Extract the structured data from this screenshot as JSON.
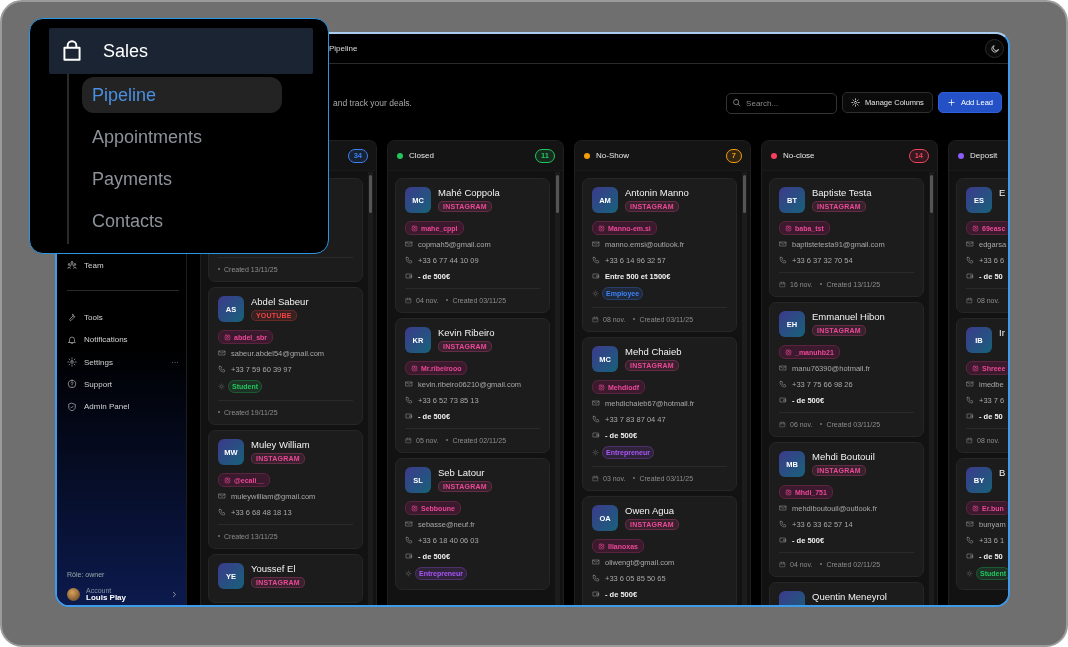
{
  "callout": {
    "group": "Sales",
    "items": [
      {
        "label": "Pipeline",
        "selected": true
      },
      {
        "label": "Appointments",
        "selected": false
      },
      {
        "label": "Payments",
        "selected": false
      },
      {
        "label": "Contacts",
        "selected": false
      }
    ]
  },
  "sidebar": {
    "items": [
      {
        "label": "Team"
      },
      {
        "label": "Tools",
        "divider_before": true
      },
      {
        "label": "Notifications"
      },
      {
        "label": "Settings",
        "more": "···"
      },
      {
        "label": "Support"
      },
      {
        "label": "Admin Panel"
      }
    ],
    "role": "Rôle: owner",
    "account": {
      "caption": "Account",
      "name": "Louis Play"
    }
  },
  "header": {
    "breadcrumb": "Pipeline"
  },
  "description": "and track your deals.",
  "toolbar": {
    "search": {
      "placeholder": "Search..."
    },
    "manage": "Manage Columns",
    "add": "Add Lead"
  },
  "columns": [
    {
      "count": "34",
      "color": "#3b82f6",
      "cards": [
        {
          "created": "Created 13/11/25"
        },
        {
          "initials": "AS",
          "name": "Abdel Sabeur",
          "source": {
            "label": "YOUTUBE",
            "color": "#ef4444"
          },
          "handle": "abdel_sbr",
          "email": "sabeur.abdel54@gmail.com",
          "phone": "+33 7 59 60 39 97",
          "tag": {
            "label": "Student",
            "color": "#22c55e"
          },
          "created": "Created 19/11/25"
        },
        {
          "initials": "MW",
          "name": "Muley William",
          "source": {
            "label": "INSTAGRAM",
            "color": "#ec4899"
          },
          "handle": "@ecali__",
          "email": "muleywilliam@gmail.com",
          "phone": "+33 6 68 48 18 13",
          "created": "Created 13/11/25"
        },
        {
          "initials": "YE",
          "name": "Youssef El",
          "source": {
            "label": "INSTAGRAM",
            "color": "#ec4899"
          }
        }
      ]
    },
    {
      "name": "Closed",
      "count": "11",
      "color": "#22c55e",
      "cards": [
        {
          "initials": "MC",
          "name": "Mahé Coppola",
          "source": {
            "label": "INSTAGRAM",
            "color": "#ec4899"
          },
          "handle": "mahe_cppl",
          "email": "copmah5@gmail.com",
          "phone": "+33 6 77 44 10 09",
          "budget": "- de 500€",
          "date": "04 nov.",
          "created": "Created 03/11/25"
        },
        {
          "initials": "KR",
          "name": "Kevin Ribeiro",
          "source": {
            "label": "INSTAGRAM",
            "color": "#ec4899"
          },
          "handle": "Mr.ribeirooo",
          "email": "kevin.ribeiro06210@gmail.com",
          "phone": "+33 6 52 73 85 13",
          "budget": "- de 500€",
          "date": "05 nov.",
          "created": "Created 02/11/25"
        },
        {
          "initials": "SL",
          "name": "Seb Latour",
          "source": {
            "label": "INSTAGRAM",
            "color": "#ec4899"
          },
          "handle": "Sebboune",
          "email": "sebasse@neuf.fr",
          "phone": "+33 6 18 40 06 03",
          "budget": "- de 500€",
          "tag": {
            "label": "Entrepreneur",
            "color": "#a855f7"
          }
        }
      ]
    },
    {
      "name": "No-Show",
      "count": "7",
      "color": "#f59e0b",
      "cards": [
        {
          "initials": "AM",
          "name": "Antonin Manno",
          "source": {
            "label": "INSTAGRAM",
            "color": "#ec4899"
          },
          "handle": "Manno-em.si",
          "email": "manno.emsi@outlook.fr",
          "phone": "+33 6 14 96 32 57",
          "budget": "Entre 500 et 1500€",
          "tag": {
            "label": "Employee",
            "color": "#3b82f6"
          },
          "date": "08 nov.",
          "created": "Created 03/11/25"
        },
        {
          "initials": "MC",
          "name": "Mehd Chaieb",
          "source": {
            "label": "INSTAGRAM",
            "color": "#ec4899"
          },
          "handle": "Mehdiodf",
          "email": "mehdichaieb67@hotmail.fr",
          "phone": "+33 7 83 87 04 47",
          "budget": "- de 500€",
          "tag": {
            "label": "Entrepreneur",
            "color": "#a855f7"
          },
          "date": "03 nov.",
          "created": "Created 03/11/25"
        },
        {
          "initials": "OA",
          "name": "Owen Agua",
          "source": {
            "label": "INSTAGRAM",
            "color": "#ec4899"
          },
          "handle": "Ilianoxas",
          "email": "oliwengt@gmail.com",
          "phone": "+33 6 05 85 50 65",
          "budget": "- de 500€"
        }
      ]
    },
    {
      "name": "No-close",
      "count": "14",
      "color": "#f43f5e",
      "cards": [
        {
          "initials": "BT",
          "name": "Baptiste Testa",
          "source": {
            "label": "INSTAGRAM",
            "color": "#ec4899"
          },
          "handle": "baba_tst",
          "email": "baptistetesta91@gmail.com",
          "phone": "+33 6 37 32 70 54",
          "date": "16 nov.",
          "created": "Created 13/11/25"
        },
        {
          "initials": "EH",
          "name": "Emmanuel Hibon",
          "source": {
            "label": "INSTAGRAM",
            "color": "#ec4899"
          },
          "handle": "_manuhb21",
          "email": "manu76390@hotmail.fr",
          "phone": "+33 7 75 66 98 26",
          "budget": "- de 500€",
          "date": "06 nov.",
          "created": "Created 03/11/25"
        },
        {
          "initials": "MB",
          "name": "Mehdi Boutouil",
          "source": {
            "label": "INSTAGRAM",
            "color": "#ec4899"
          },
          "handle": "Mhdi_751",
          "email": "mehdiboutouil@outlook.fr",
          "phone": "+33 6 33 62 57 14",
          "budget": "- de 500€",
          "date": "04 nov.",
          "created": "Created 02/11/25"
        },
        {
          "name": "Quentin Meneyrol"
        }
      ]
    },
    {
      "name": "Deposit",
      "color": "#8b5cf6",
      "cards": [
        {
          "initials": "ES",
          "name": "E",
          "handle": "69easc",
          "email": "edgarsa",
          "phone": "+33 6 6",
          "budget": "- de 50",
          "date": "08 nov."
        },
        {
          "initials": "IB",
          "name": "Ir",
          "handle": "Shreee",
          "email": "imedbe",
          "phone": "+33 7 6",
          "budget": "- de 50",
          "date": "08 nov."
        },
        {
          "initials": "BY",
          "name": "B",
          "handle": "Er.bun",
          "email": "bunyam",
          "phone": "+33 6 1",
          "budget": "- de 50",
          "tag": {
            "label": "Student",
            "color": "#22c55e"
          }
        }
      ]
    }
  ]
}
